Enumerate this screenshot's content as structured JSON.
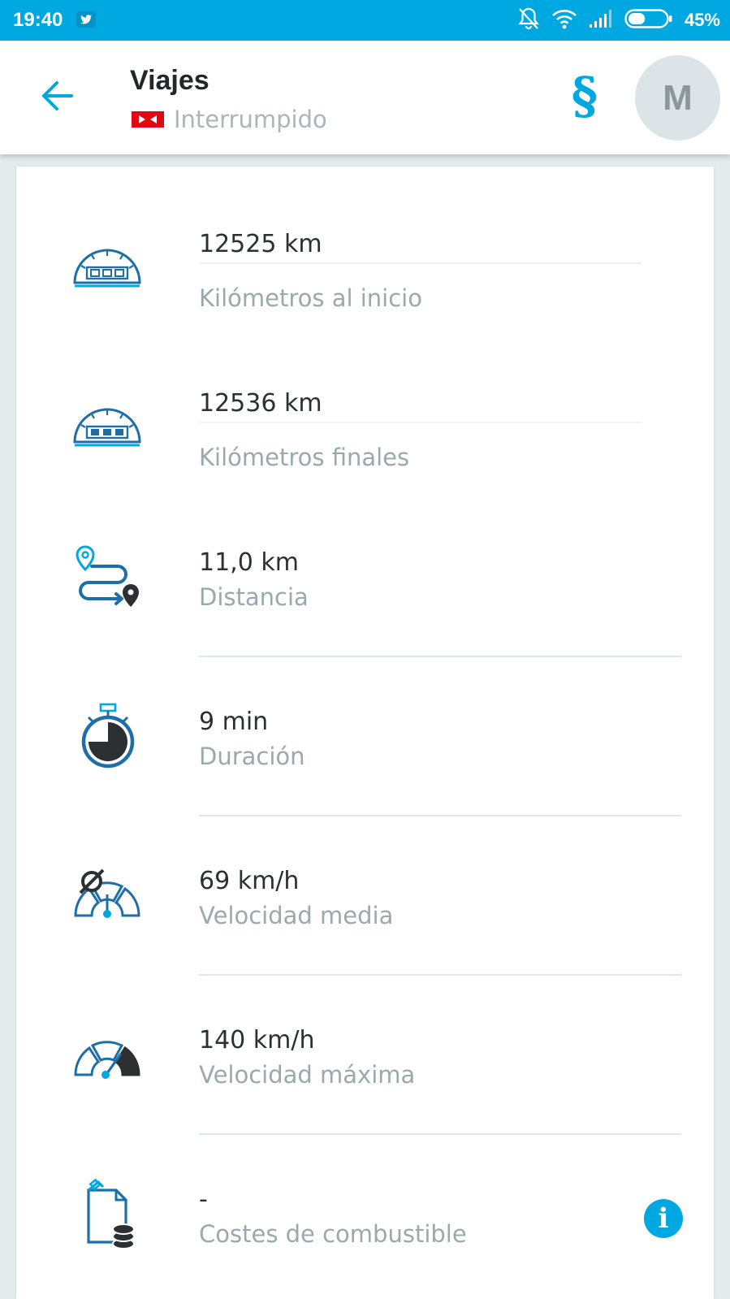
{
  "status_bar": {
    "time": "19:40",
    "battery_percent": "45%",
    "battery_level": 0.45,
    "icons": [
      "twitter-icon",
      "bell-off-icon",
      "wifi-icon",
      "signal-icon",
      "battery-icon"
    ]
  },
  "app_bar": {
    "title": "Viajes",
    "status": "Interrumpido",
    "section_symbol": "§",
    "avatar_initial": "M",
    "accent_color": "#00a8e2"
  },
  "rows": [
    {
      "icon": "odometer-start-icon",
      "value": "12525 km",
      "label": "Kilómetros al inicio"
    },
    {
      "icon": "odometer-end-icon",
      "value": "12536 km",
      "label": "Kilómetros finales"
    },
    {
      "icon": "route-icon",
      "value": "11,0 km",
      "label": "Distancia"
    },
    {
      "icon": "stopwatch-icon",
      "value": "9 min",
      "label": "Duración"
    },
    {
      "icon": "average-speed-icon",
      "value": "69 km/h",
      "label": "Velocidad media"
    },
    {
      "icon": "max-speed-icon",
      "value": "140 km/h",
      "label": "Velocidad máxima"
    },
    {
      "icon": "fuel-cost-icon",
      "value": "-",
      "label": "Costes de combustible"
    }
  ],
  "info_symbol": "i"
}
